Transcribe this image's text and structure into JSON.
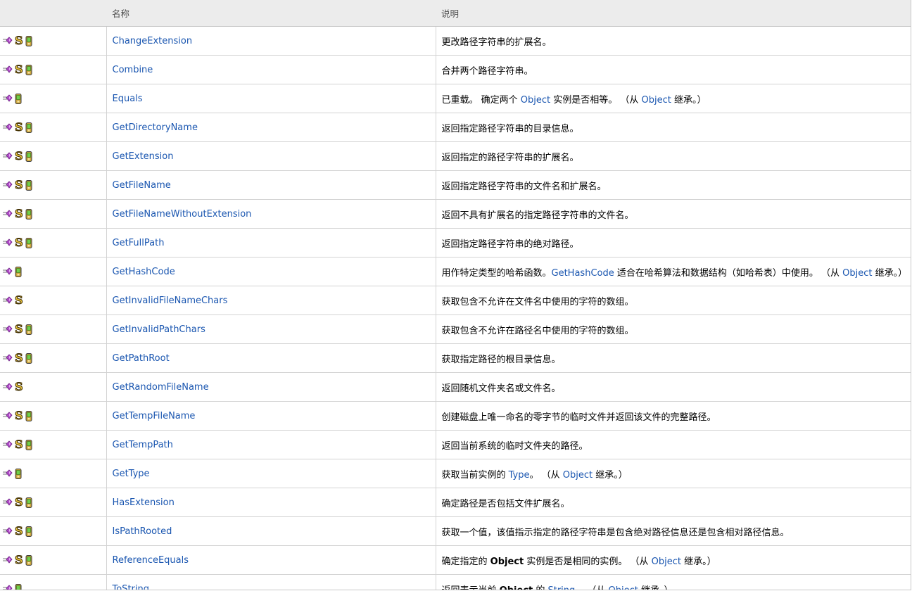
{
  "header": {
    "name_label": "名称",
    "desc_label": "说明"
  },
  "rows": [
    {
      "name": "ChangeExtension",
      "static": true,
      "xna": true,
      "desc": [
        {
          "t": "更改路径字符串的扩展名。"
        }
      ]
    },
    {
      "name": "Combine",
      "static": true,
      "xna": true,
      "desc": [
        {
          "t": "合并两个路径字符串。"
        }
      ]
    },
    {
      "name": "Equals",
      "static": false,
      "xna": true,
      "desc": [
        {
          "t": "已重载。 确定两个 "
        },
        {
          "t": "Object",
          "link": true
        },
        {
          "t": " 实例是否相等。 （从 "
        },
        {
          "t": "Object",
          "link": true
        },
        {
          "t": " 继承。）"
        }
      ]
    },
    {
      "name": "GetDirectoryName",
      "static": true,
      "xna": true,
      "desc": [
        {
          "t": "返回指定路径字符串的目录信息。"
        }
      ]
    },
    {
      "name": "GetExtension",
      "static": true,
      "xna": true,
      "desc": [
        {
          "t": "返回指定的路径字符串的扩展名。"
        }
      ]
    },
    {
      "name": "GetFileName",
      "static": true,
      "xna": true,
      "desc": [
        {
          "t": "返回指定路径字符串的文件名和扩展名。"
        }
      ]
    },
    {
      "name": "GetFileNameWithoutExtension",
      "static": true,
      "xna": true,
      "desc": [
        {
          "t": "返回不具有扩展名的指定路径字符串的文件名。"
        }
      ]
    },
    {
      "name": "GetFullPath",
      "static": true,
      "xna": true,
      "desc": [
        {
          "t": "返回指定路径字符串的绝对路径。"
        }
      ]
    },
    {
      "name": "GetHashCode",
      "static": false,
      "xna": true,
      "desc": [
        {
          "t": "用作特定类型的哈希函数。"
        },
        {
          "t": "GetHashCode",
          "link": true
        },
        {
          "t": " 适合在哈希算法和数据结构（如哈希表）中使用。 （从 "
        },
        {
          "t": "Object",
          "link": true
        },
        {
          "t": " 继承。）"
        }
      ]
    },
    {
      "name": "GetInvalidFileNameChars",
      "static": true,
      "xna": false,
      "desc": [
        {
          "t": "获取包含不允许在文件名中使用的字符的数组。"
        }
      ]
    },
    {
      "name": "GetInvalidPathChars",
      "static": true,
      "xna": true,
      "desc": [
        {
          "t": "获取包含不允许在路径名中使用的字符的数组。"
        }
      ]
    },
    {
      "name": "GetPathRoot",
      "static": true,
      "xna": true,
      "desc": [
        {
          "t": "获取指定路径的根目录信息。"
        }
      ]
    },
    {
      "name": "GetRandomFileName",
      "static": true,
      "xna": false,
      "desc": [
        {
          "t": "返回随机文件夹名或文件名。"
        }
      ]
    },
    {
      "name": "GetTempFileName",
      "static": true,
      "xna": true,
      "desc": [
        {
          "t": "创建磁盘上唯一命名的零字节的临时文件并返回该文件的完整路径。"
        }
      ]
    },
    {
      "name": "GetTempPath",
      "static": true,
      "xna": true,
      "desc": [
        {
          "t": "返回当前系统的临时文件夹的路径。"
        }
      ]
    },
    {
      "name": "GetType",
      "static": false,
      "xna": true,
      "desc": [
        {
          "t": "获取当前实例的 "
        },
        {
          "t": "Type",
          "link": true
        },
        {
          "t": "。 （从 "
        },
        {
          "t": "Object",
          "link": true
        },
        {
          "t": " 继承。）"
        }
      ]
    },
    {
      "name": "HasExtension",
      "static": true,
      "xna": true,
      "desc": [
        {
          "t": "确定路径是否包括文件扩展名。"
        }
      ]
    },
    {
      "name": "IsPathRooted",
      "static": true,
      "xna": true,
      "desc": [
        {
          "t": "获取一个值，该值指示指定的路径字符串是包含绝对路径信息还是包含相对路径信息。"
        }
      ]
    },
    {
      "name": "ReferenceEquals",
      "static": true,
      "xna": true,
      "desc": [
        {
          "t": "确定指定的 "
        },
        {
          "t": "Object",
          "bold": true
        },
        {
          "t": " 实例是否是相同的实例。 （从 "
        },
        {
          "t": "Object",
          "link": true
        },
        {
          "t": " 继承。）"
        }
      ]
    },
    {
      "name": "ToString",
      "static": false,
      "xna": true,
      "desc": [
        {
          "t": "返回表示当前 "
        },
        {
          "t": "Object",
          "bold": true
        },
        {
          "t": " 的 "
        },
        {
          "t": "String",
          "link": true
        },
        {
          "t": "。 （从 "
        },
        {
          "t": "Object",
          "link": true
        },
        {
          "t": " 继承。）"
        }
      ]
    }
  ],
  "icons": {
    "method": "public-method-icon",
    "static": "static-member-icon",
    "xna": "xna-framework-icon"
  },
  "colors": {
    "link": "#1a56b0",
    "header_bg": "#ececec",
    "grid": "#d3d3d3",
    "static_icon": "#e8c23a",
    "method_icon": "#b04cc8"
  }
}
